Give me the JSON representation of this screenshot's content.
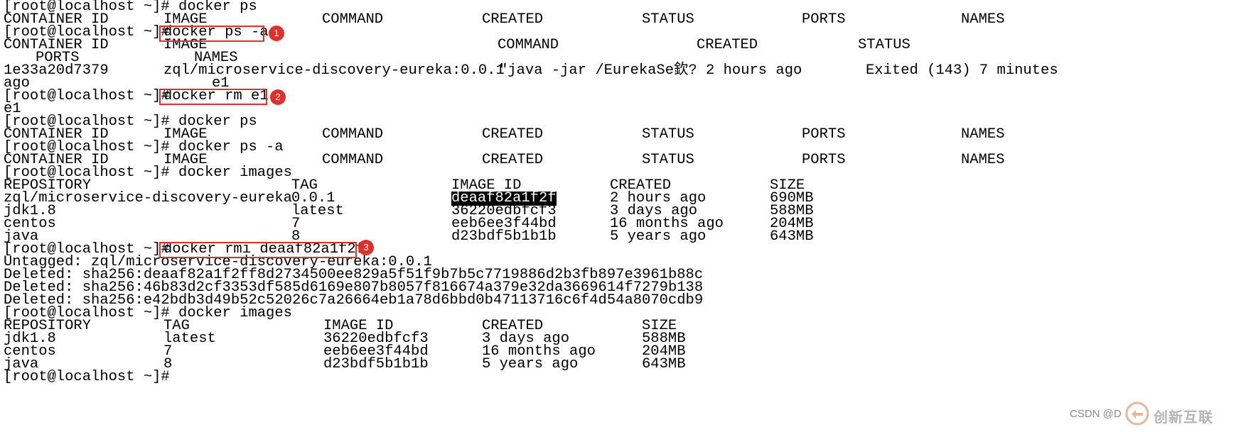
{
  "terminal": {
    "lines": [
      {
        "segs": [
          "[root@localhost ~]# docker ps"
        ]
      },
      {
        "segs": [
          "CONTAINER ID",
          "IMAGE",
          "COMMAND",
          "CREATED",
          "STATUS",
          "PORTS",
          "NAMES"
        ]
      },
      {
        "segs": [
          "[root@localhost ~]# ",
          "docker ps -a"
        ]
      },
      {
        "segs": [
          "CONTAINER ID",
          "IMAGE",
          "COMMAND",
          "CREATED",
          "STATUS"
        ]
      },
      {
        "segs": [
          "PORTS",
          "NAMES"
        ]
      },
      {
        "segs": [
          "1e33a20d7379",
          "zql/microservice-discovery-eureka:0.0.1",
          "\"java -jar /EurekaSe欽?",
          "2 hours ago",
          "Exited (143) 7 minutes"
        ]
      },
      {
        "segs": [
          "ago",
          "e1"
        ]
      },
      {
        "segs": [
          "[root@localhost ~]# ",
          "docker rm e1"
        ]
      },
      {
        "segs": [
          "e1"
        ]
      },
      {
        "segs": [
          "[root@localhost ~]# docker ps"
        ]
      },
      {
        "segs": [
          "CONTAINER ID",
          "IMAGE",
          "COMMAND",
          "CREATED",
          "STATUS",
          "PORTS",
          "NAMES"
        ]
      },
      {
        "segs": [
          "[root@localhost ~]# docker ps -a"
        ]
      },
      {
        "segs": [
          "CONTAINER ID",
          "IMAGE",
          "COMMAND",
          "CREATED",
          "STATUS",
          "PORTS",
          "NAMES"
        ]
      },
      {
        "segs": [
          "[root@localhost ~]# docker images"
        ]
      },
      {
        "segs": [
          "REPOSITORY",
          "TAG",
          "IMAGE ID",
          "CREATED",
          "SIZE"
        ]
      },
      {
        "segs": [
          "zql/microservice-discovery-eureka",
          "0.0.1",
          "deaaf82a1f2f",
          "2 hours ago",
          "690MB"
        ]
      },
      {
        "segs": [
          "jdk1.8",
          "latest",
          "36220edbfcf3",
          "3 days ago",
          "588MB"
        ]
      },
      {
        "segs": [
          "centos",
          "7",
          "eeb6ee3f44bd",
          "16 months ago",
          "204MB"
        ]
      },
      {
        "segs": [
          "java",
          "8",
          "d23bdf5b1b1b",
          "5 years ago",
          "643MB"
        ]
      },
      {
        "segs": [
          "[root@localhost ~]# ",
          "docker rmi deaaf82a1f2f"
        ]
      },
      {
        "segs": [
          "Untagged: zql/microservice-discovery-eureka:0.0.1"
        ]
      },
      {
        "segs": [
          "Deleted: sha256:deaaf82a1f2ff8d2734500ee829a5f51f9b7b5c7719886d2b3fb897e3961b88c"
        ]
      },
      {
        "segs": [
          "Deleted: sha256:46b83d2cf3353df585d6169e807b8057f816674a379e32da3669614f7279b138"
        ]
      },
      {
        "segs": [
          "Deleted: sha256:e42bdb3d49b52c52026c7a26664eb1a78d6bbd0b47113716c6f4d54a8070cdb9"
        ]
      },
      {
        "segs": [
          "[root@localhost ~]# docker images"
        ]
      },
      {
        "segs": [
          "REPOSITORY",
          "TAG",
          "IMAGE ID",
          "CREATED",
          "SIZE"
        ]
      },
      {
        "segs": [
          "jdk1.8",
          "latest",
          "36220edbfcf3",
          "3 days ago",
          "588MB"
        ]
      },
      {
        "segs": [
          "centos",
          "7",
          "eeb6ee3f44bd",
          "16 months ago",
          "204MB"
        ]
      },
      {
        "segs": [
          "java",
          "8",
          "d23bdf5b1b1b",
          "5 years ago",
          "643MB"
        ]
      },
      {
        "segs": [
          "[root@localhost ~]# "
        ]
      }
    ]
  },
  "annotations": [
    {
      "number": "1"
    },
    {
      "number": "2"
    },
    {
      "number": "3"
    }
  ],
  "watermark": {
    "text": "CSDN @D",
    "brand": "创新互联"
  },
  "colors": {
    "annotation_red": "#d9322b",
    "highlight_bg": "#000000",
    "highlight_fg": "#ffffff",
    "text": "#000000",
    "background": "#ffffff"
  }
}
